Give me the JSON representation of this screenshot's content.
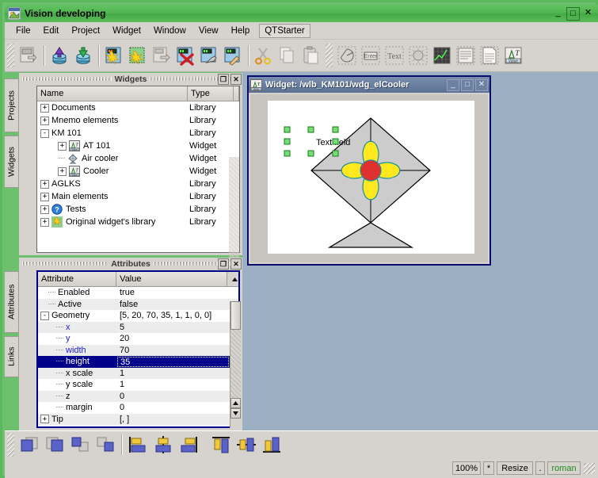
{
  "window": {
    "title": "Vision developing",
    "icon": "app-icon",
    "buttons": [
      {
        "name": "minimize",
        "glyph": "_"
      },
      {
        "name": "maximize",
        "glyph": "□"
      },
      {
        "name": "close",
        "glyph": "✕"
      }
    ]
  },
  "menu": {
    "items": [
      {
        "name": "file",
        "label": "File"
      },
      {
        "name": "edit",
        "label": "Edit"
      },
      {
        "name": "project",
        "label": "Project"
      },
      {
        "name": "widget",
        "label": "Widget"
      },
      {
        "name": "window",
        "label": "Window"
      },
      {
        "name": "view",
        "label": "View"
      },
      {
        "name": "help",
        "label": "Help"
      }
    ],
    "boxed": {
      "name": "qtstarter",
      "label": "QTStarter"
    }
  },
  "toolbar": {
    "groups": [
      {
        "icons": [
          "save-document-icon"
        ]
      },
      {
        "icons": [
          "db-load-icon",
          "db-save-icon"
        ]
      },
      {
        "icons": [
          "new-widget-icon",
          "new-library-icon",
          "copy-widget-icon",
          "delete-widget-icon",
          "edit-widget-icon",
          "properties-widget-icon"
        ]
      },
      {
        "icons": [
          "cut-icon",
          "copy-icon",
          "paste-icon"
        ]
      },
      {
        "icons": [
          "shape-elementary-icon",
          "form-element-icon",
          "text-element-icon",
          "media-element-icon",
          "diagram-element-icon",
          "protocol-element-icon",
          "document-element-icon",
          "value-element-icon"
        ]
      }
    ]
  },
  "docks": {
    "top_tabs": [
      {
        "name": "projects",
        "label": "Projects"
      },
      {
        "name": "widgets",
        "label": "Widgets"
      }
    ],
    "bottom_tabs": [
      {
        "name": "attributes",
        "label": "Attributes"
      },
      {
        "name": "links",
        "label": "Links"
      }
    ]
  },
  "widgets_panel": {
    "title": "Widgets",
    "panel_buttons": [
      {
        "name": "float",
        "glyph": "❐"
      },
      {
        "name": "close",
        "glyph": "✕"
      }
    ],
    "columns": [
      {
        "name": "name",
        "label": "Name"
      },
      {
        "name": "type",
        "label": "Type"
      }
    ],
    "rows": [
      {
        "indent": 0,
        "expander": "+",
        "icon": "",
        "name": "Documents",
        "type": "Library"
      },
      {
        "indent": 0,
        "expander": "+",
        "icon": "",
        "name": "Mnemo elements",
        "type": "Library"
      },
      {
        "indent": 0,
        "expander": "-",
        "icon": "",
        "name": "KM 101",
        "type": "Library"
      },
      {
        "indent": 1,
        "expander": "+",
        "icon": "value-widget-icon",
        "name": "AT 101",
        "type": "Widget"
      },
      {
        "indent": 1,
        "expander": "",
        "icon": "air-cooler-icon",
        "name": "Air cooler",
        "type": "Widget"
      },
      {
        "indent": 1,
        "expander": "+",
        "icon": "value-widget-icon",
        "name": "Cooler",
        "type": "Widget"
      },
      {
        "indent": 0,
        "expander": "+",
        "icon": "",
        "name": "AGLKS",
        "type": "Library"
      },
      {
        "indent": 0,
        "expander": "+",
        "icon": "",
        "name": "Main elements",
        "type": "Library"
      },
      {
        "indent": 0,
        "expander": "+",
        "icon": "question-icon",
        "name": "Tests",
        "type": "Library"
      },
      {
        "indent": 0,
        "expander": "+",
        "icon": "star-icon",
        "name": "Original widget's library",
        "type": "Library"
      }
    ]
  },
  "attributes_panel": {
    "title": "Attributes",
    "panel_buttons": [
      {
        "name": "float",
        "glyph": "❐"
      },
      {
        "name": "close",
        "glyph": "✕"
      }
    ],
    "columns": [
      {
        "name": "attribute",
        "label": "Attribute"
      },
      {
        "name": "value",
        "label": "Value"
      }
    ],
    "rows": [
      {
        "indent": 1,
        "expander": "",
        "attribute": "Enabled",
        "value": "true",
        "sub": false,
        "selected": false
      },
      {
        "indent": 1,
        "expander": "",
        "attribute": "Active",
        "value": "false",
        "sub": false,
        "selected": false
      },
      {
        "indent": 0,
        "expander": "-",
        "attribute": "Geometry",
        "value": "[5, 20, 70, 35, 1, 1, 0, 0]",
        "sub": false,
        "selected": false
      },
      {
        "indent": 2,
        "expander": "",
        "attribute": "x",
        "value": "5",
        "sub": true,
        "selected": false
      },
      {
        "indent": 2,
        "expander": "",
        "attribute": "y",
        "value": "20",
        "sub": true,
        "selected": false
      },
      {
        "indent": 2,
        "expander": "",
        "attribute": "width",
        "value": "70",
        "sub": true,
        "selected": false
      },
      {
        "indent": 2,
        "expander": "",
        "attribute": "height",
        "value": "35",
        "sub": false,
        "selected": true
      },
      {
        "indent": 2,
        "expander": "",
        "attribute": "x scale",
        "value": "1",
        "sub": false,
        "selected": false
      },
      {
        "indent": 2,
        "expander": "",
        "attribute": "y scale",
        "value": "1",
        "sub": false,
        "selected": false
      },
      {
        "indent": 2,
        "expander": "",
        "attribute": "z",
        "value": "0",
        "sub": false,
        "selected": false
      },
      {
        "indent": 2,
        "expander": "",
        "attribute": "margin",
        "value": "0",
        "sub": false,
        "selected": false
      },
      {
        "indent": 0,
        "expander": "+",
        "attribute": "Tip",
        "value": "[, ]",
        "sub": false,
        "selected": false
      }
    ]
  },
  "subwindow": {
    "title": "Widget: /wlb_KM101/wdg_elCooler",
    "icon": "value-widget-icon",
    "buttons": [
      {
        "name": "minimize",
        "glyph": "_"
      },
      {
        "name": "maximize",
        "glyph": "□"
      },
      {
        "name": "close",
        "glyph": "✕"
      }
    ],
    "canvas": {
      "text_element": "Text field",
      "selection_handle_color": "#77dd77",
      "fan_blade_color": "#ffe91e",
      "fan_hub_color": "#e03131",
      "body_fill_color": "#cccccc"
    }
  },
  "bottom_toolbar": {
    "groups": [
      {
        "icons": [
          "bring-to-front-icon",
          "send-to-back-icon",
          "raise-icon",
          "lower-icon"
        ]
      },
      {
        "icons": [
          "align-left-icon",
          "align-vertical-center-icon",
          "align-right-icon",
          "align-top-icon",
          "align-horizontal-center-icon",
          "align-bottom-icon"
        ]
      }
    ]
  },
  "statusbar": {
    "fields": [
      {
        "name": "zoom-level",
        "label": "100%",
        "green": false
      },
      {
        "name": "modified-flag",
        "label": "*",
        "green": false
      },
      {
        "name": "edit-mode",
        "label": "Resize",
        "green": false
      },
      {
        "name": "separator-field",
        "label": ".",
        "green": false
      },
      {
        "name": "font-name",
        "label": "roman",
        "green": true
      }
    ]
  }
}
